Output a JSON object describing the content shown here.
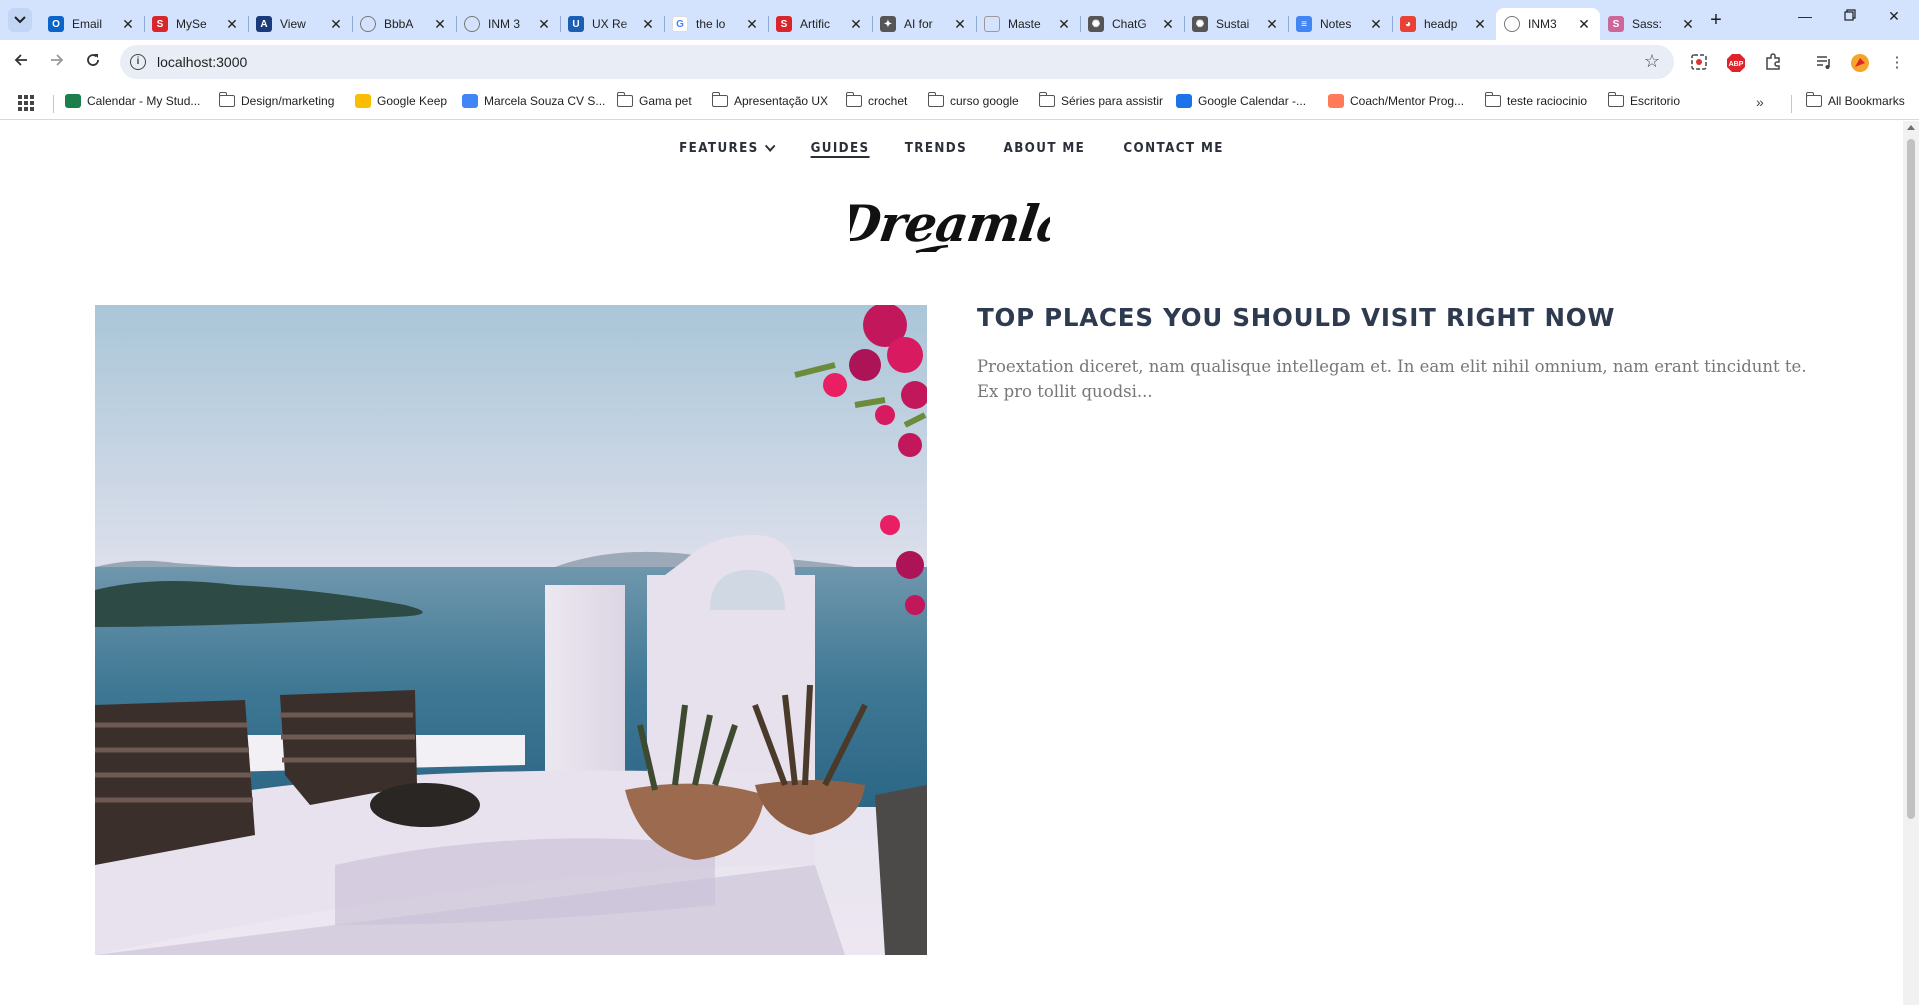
{
  "browser": {
    "tabs": [
      {
        "title": "Email",
        "favicon": "outlook-icon",
        "color": "#0a64c9",
        "letter": "O"
      },
      {
        "title": "MySe",
        "favicon": "s-icon",
        "color": "#d9262c",
        "letter": "S"
      },
      {
        "title": "View",
        "favicon": "a-icon",
        "color": "#1b3a7a",
        "letter": "A"
      },
      {
        "title": "BbbA",
        "favicon": "globe-icon",
        "color": "#777777",
        "letter": ""
      },
      {
        "title": "INM 3",
        "favicon": "globe-icon",
        "color": "#777777",
        "letter": ""
      },
      {
        "title": "UX Re",
        "favicon": "doc-icon",
        "color": "#1b5fb5",
        "letter": "U"
      },
      {
        "title": "the lo",
        "favicon": "google-icon",
        "color": "#ffffff",
        "letter": "G"
      },
      {
        "title": "Artific",
        "favicon": "s-icon",
        "color": "#d9262c",
        "letter": "S"
      },
      {
        "title": "AI for",
        "favicon": "ai-icon",
        "color": "#555555",
        "letter": "✦"
      },
      {
        "title": "Maste",
        "favicon": "page-icon",
        "color": "#999999",
        "letter": ""
      },
      {
        "title": "ChatG",
        "favicon": "openai-icon",
        "color": "#555555",
        "letter": "✺"
      },
      {
        "title": "Sustai",
        "favicon": "openai-icon",
        "color": "#555555",
        "letter": "✺"
      },
      {
        "title": "Notes",
        "favicon": "docs-icon",
        "color": "#4285f4",
        "letter": "≡"
      },
      {
        "title": "headp",
        "favicon": "chrome-icon",
        "color": "#e94235",
        "letter": "◕"
      },
      {
        "title": "INM3",
        "favicon": "globe-icon",
        "color": "#777777",
        "letter": "",
        "active": true
      },
      {
        "title": "Sass:",
        "favicon": "sass-icon",
        "color": "#cd6799",
        "letter": "S"
      }
    ],
    "url": "localhost:3000",
    "bookmarks": [
      {
        "label": "Calendar - My Stud...",
        "icon": "calendar-icon"
      },
      {
        "label": "Design/marketing",
        "icon": "folder-icon"
      },
      {
        "label": "Google Keep",
        "icon": "keep-icon"
      },
      {
        "label": "Marcela Souza CV S...",
        "icon": "docs-icon"
      },
      {
        "label": "Gama pet",
        "icon": "folder-icon"
      },
      {
        "label": "Apresentação UX",
        "icon": "folder-icon"
      },
      {
        "label": "crochet",
        "icon": "folder-icon"
      },
      {
        "label": "curso google",
        "icon": "folder-icon"
      },
      {
        "label": "Séries para assistir",
        "icon": "folder-icon"
      },
      {
        "label": "Google Calendar -...",
        "icon": "gcal-icon"
      },
      {
        "label": "Coach/Mentor Prog...",
        "icon": "coach-icon"
      },
      {
        "label": "teste raciocinio",
        "icon": "folder-icon"
      },
      {
        "label": "Escritorio",
        "icon": "folder-icon"
      }
    ],
    "all_bookmarks": "All Bookmarks"
  },
  "site": {
    "nav": [
      {
        "label": "FEATURES",
        "dropdown": true
      },
      {
        "label": "GUIDES",
        "current": true
      },
      {
        "label": "TRENDS"
      },
      {
        "label": "ABOUT ME"
      },
      {
        "label": "CONTACT ME"
      }
    ],
    "logo": "Dreamla",
    "post": {
      "title": "TOP PLACES YOU SHOULD VISIT RIGHT NOW",
      "excerpt": "Proextation diceret, nam qualisque intellegam et. In eam elit nihil omnium, nam erant tincidunt te. Ex pro tollit quodsi..."
    }
  }
}
